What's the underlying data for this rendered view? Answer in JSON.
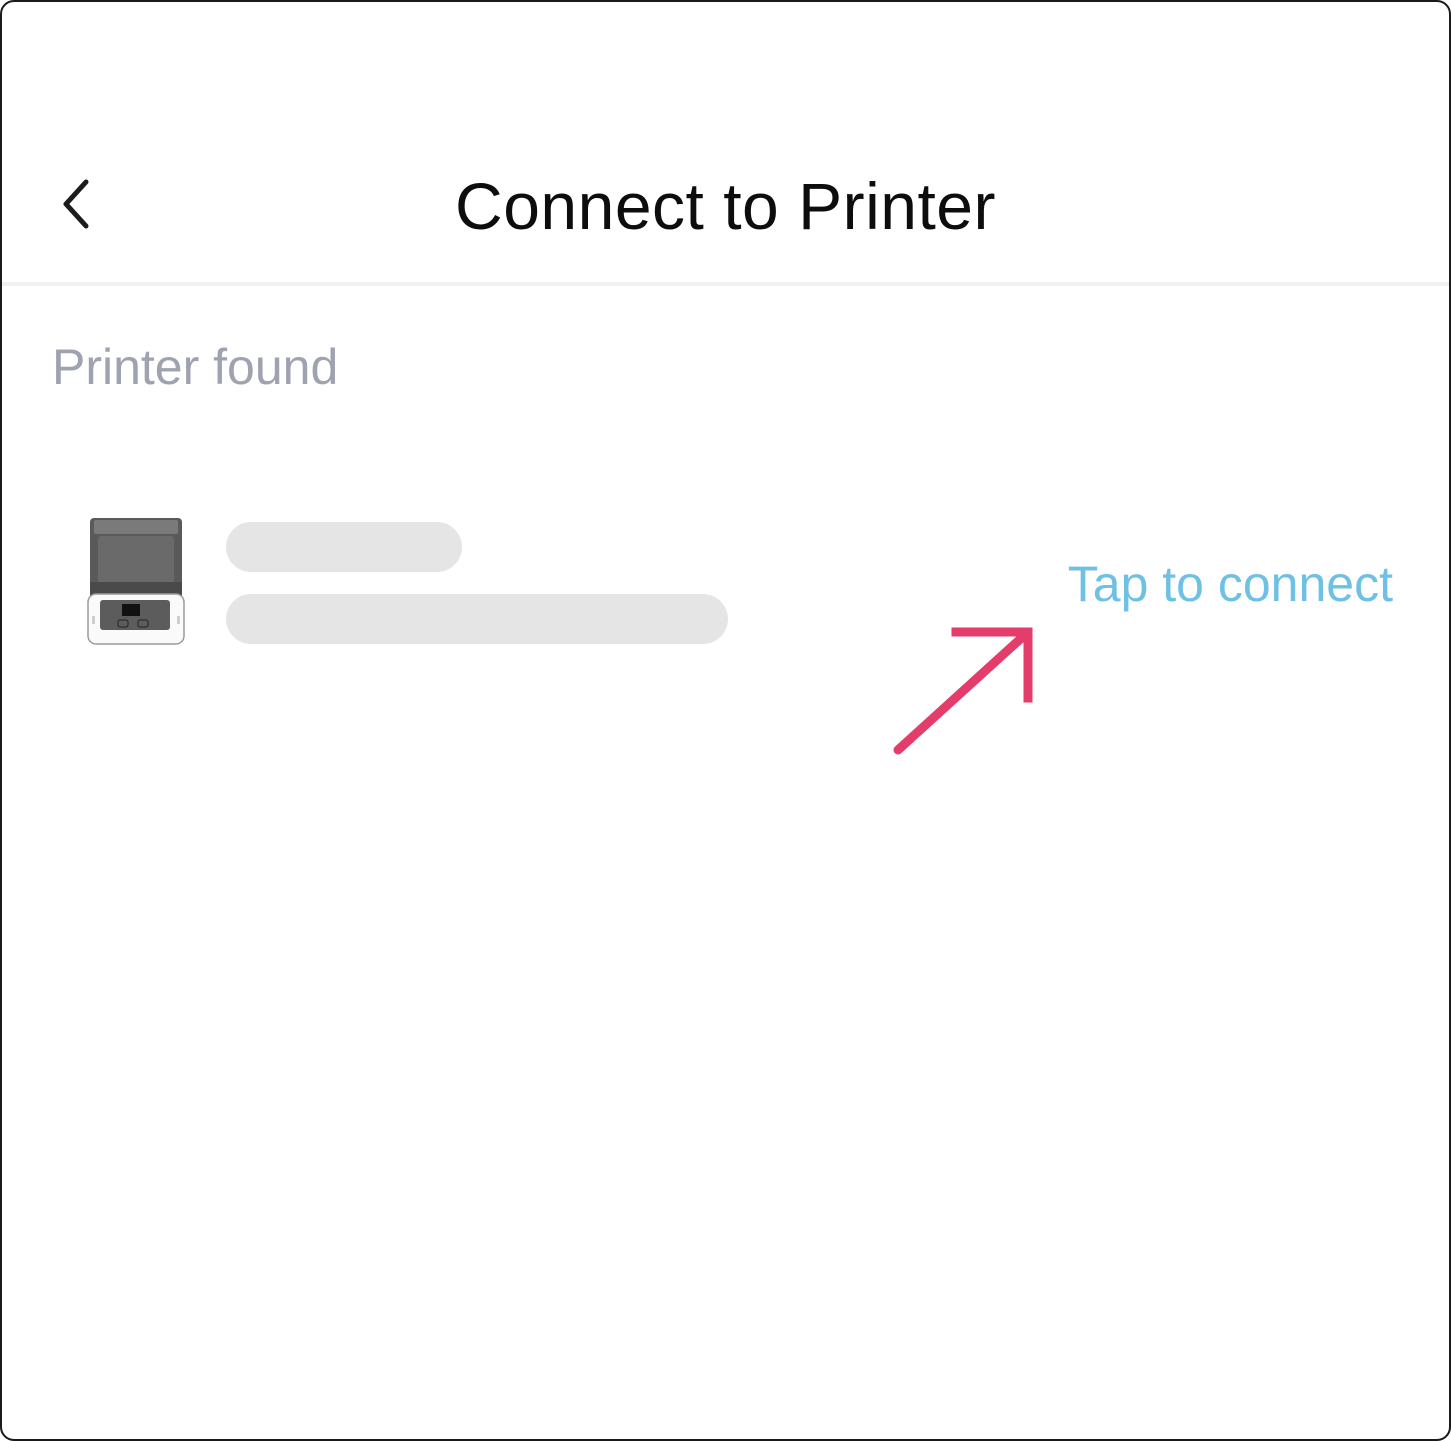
{
  "header": {
    "title": "Connect to Printer",
    "back_icon": "chevron-left-icon"
  },
  "section": {
    "label": "Printer found"
  },
  "printer": {
    "image_icon": "printer-device-icon",
    "action_label": "Tap to connect"
  },
  "colors": {
    "title": "#0d0d0d",
    "section_label": "#9ea3af",
    "link": "#6ec1e4",
    "skeleton": "#e5e5e5",
    "annotation_arrow": "#e43d6b",
    "divider": "#f1f1f3"
  },
  "annotation": {
    "icon": "arrow-up-right-icon"
  }
}
